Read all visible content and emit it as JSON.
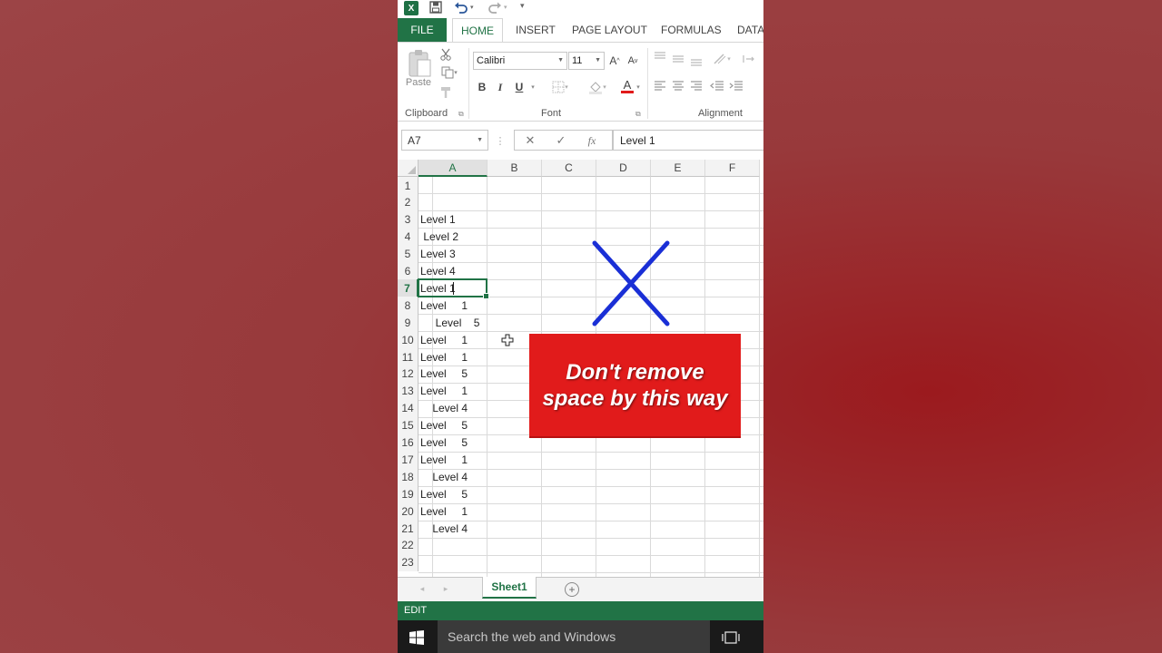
{
  "qat": {
    "logo": "X",
    "save_icon": "save-icon",
    "undo_icon": "undo-icon",
    "redo_icon": "redo-icon"
  },
  "tabs": [
    "FILE",
    "HOME",
    "INSERT",
    "PAGE LAYOUT",
    "FORMULAS",
    "DATA"
  ],
  "ribbon": {
    "paste_label": "Paste",
    "clipboard_label": "Clipboard",
    "font_label": "Font",
    "alignment_label": "Alignment",
    "font_name": "Calibri",
    "font_size": "11",
    "bold": "B",
    "italic": "I",
    "underline": "U",
    "grow": "A",
    "shrink": "A",
    "font_color": "A"
  },
  "formula_bar": {
    "name_box": "A7",
    "cancel": "✕",
    "enter": "✓",
    "fx": "fx",
    "value": "Level 1"
  },
  "columns": [
    "A",
    "B",
    "C",
    "D",
    "E",
    "F"
  ],
  "rows": [
    "1",
    "2",
    "3",
    "4",
    "5",
    "6",
    "7",
    "8",
    "9",
    "10",
    "11",
    "12",
    "13",
    "14",
    "15",
    "16",
    "17",
    "18",
    "19",
    "20",
    "21",
    "22",
    "23"
  ],
  "cells": [
    "",
    "",
    "Level 1",
    " Level 2",
    "Level 3",
    "Level 4",
    "Level 1",
    "Level     1",
    "     Level    5",
    "Level     1",
    "Level     1",
    "Level     5",
    "Level     1",
    "    Level 4",
    "Level     5",
    "Level     5",
    "Level     1",
    "    Level 4",
    "Level     5",
    "Level     1",
    "    Level 4",
    "",
    ""
  ],
  "banner": {
    "line1": "Don't remove",
    "line2": "space by this way"
  },
  "sheet_tab": "Sheet1",
  "status": "EDIT",
  "taskbar": {
    "search_placeholder": "Search the web and Windows"
  },
  "colors": {
    "accent": "#217346",
    "banner": "#e11b1b",
    "x_mark": "#1a2fd6"
  }
}
